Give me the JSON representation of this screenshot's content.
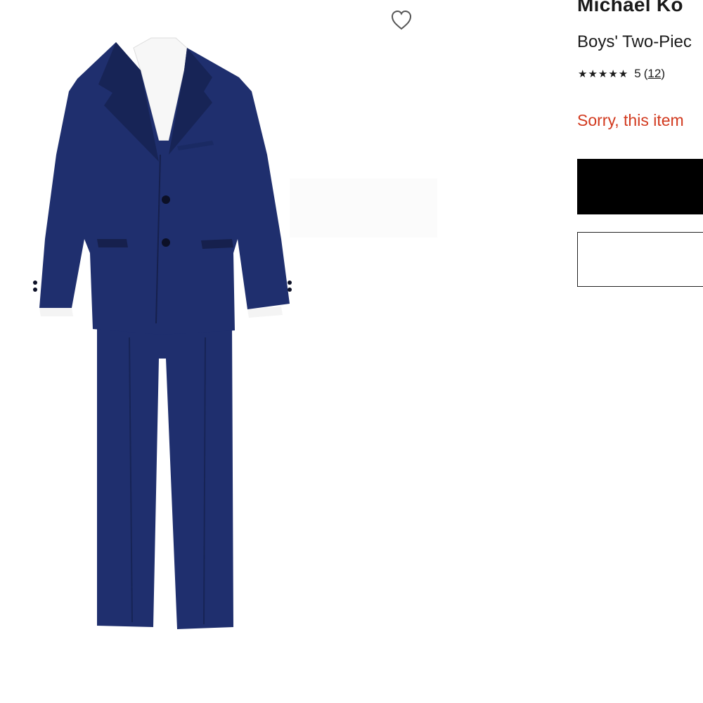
{
  "product": {
    "brand": "Michael Ko",
    "title": "Boys' Two-Piec",
    "rating": {
      "stars": "★★★★★",
      "value": "5",
      "open_paren": "(",
      "count": "12",
      "close_paren": ")"
    },
    "availability_message": "Sorry, this item",
    "image_alt": "Navy two-piece suit with white shirt"
  },
  "colors": {
    "suit_navy": "#1f2f6e",
    "suit_shadow": "#172456",
    "shirt_white": "#f7f7f7",
    "error_red": "#d23a1f"
  },
  "icons": {
    "favorite": "heart-outline-icon"
  }
}
